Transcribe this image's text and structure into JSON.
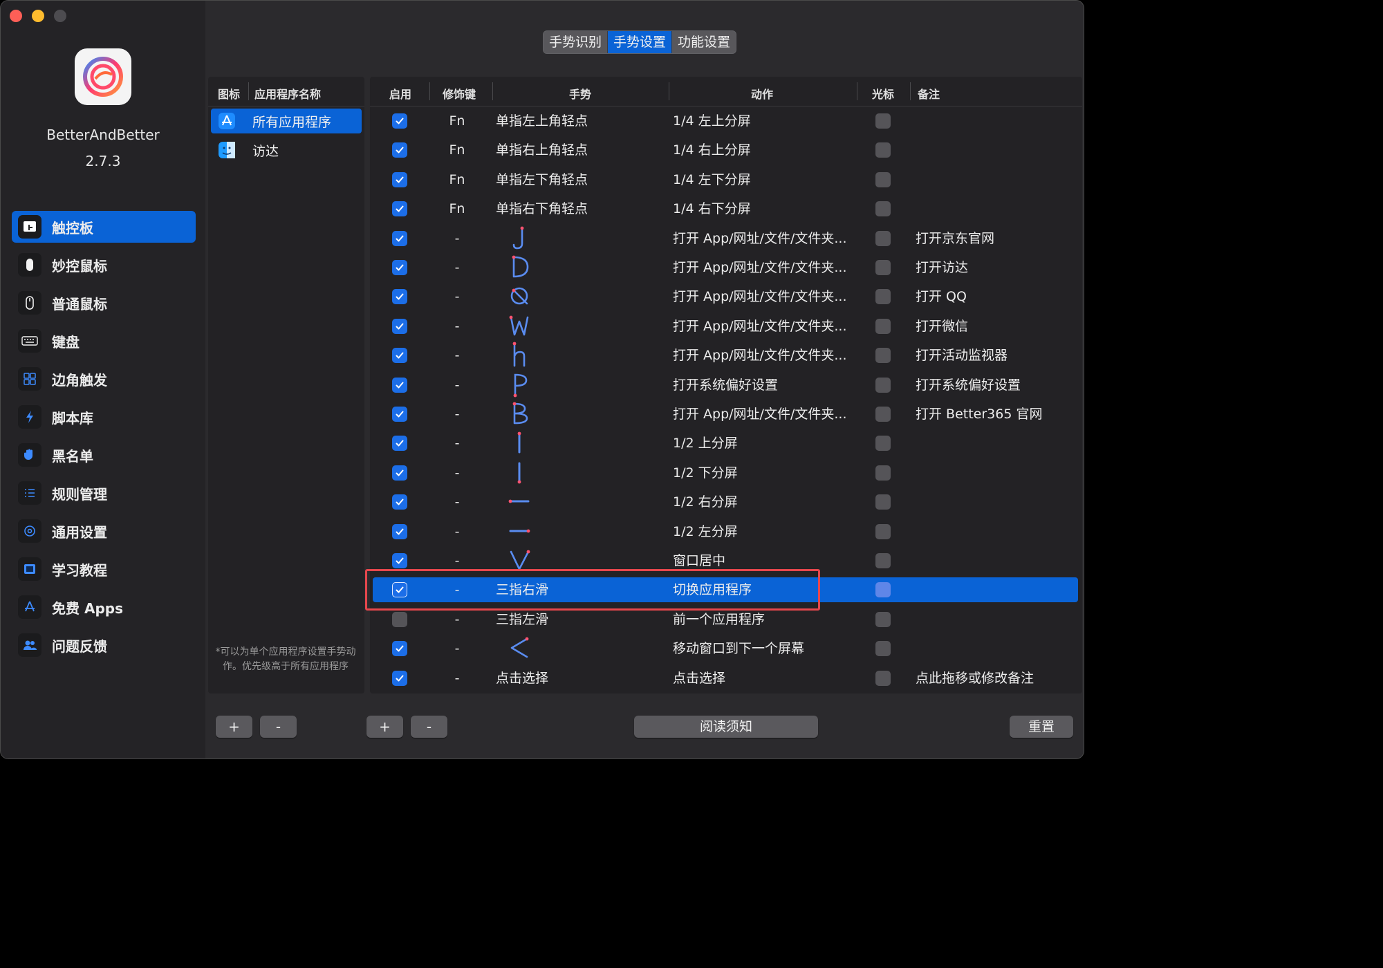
{
  "app": {
    "name": "BetterAndBetter",
    "version": "2.7.3"
  },
  "sidebar": {
    "items": [
      {
        "label": "触控板",
        "icon": "trackpad-icon"
      },
      {
        "label": "妙控鼠标",
        "icon": "magic-mouse-icon"
      },
      {
        "label": "普通鼠标",
        "icon": "mouse-icon"
      },
      {
        "label": "键盘",
        "icon": "keyboard-icon"
      },
      {
        "label": "边角触发",
        "icon": "hot-corners-icon"
      },
      {
        "label": "脚本库",
        "icon": "script-icon"
      },
      {
        "label": "黑名单",
        "icon": "hand-icon"
      },
      {
        "label": "规则管理",
        "icon": "list-icon"
      },
      {
        "label": "通用设置",
        "icon": "gear-icon"
      },
      {
        "label": "学习教程",
        "icon": "video-icon"
      },
      {
        "label": "免费 Apps",
        "icon": "app-store-icon"
      },
      {
        "label": "问题反馈",
        "icon": "people-icon"
      }
    ]
  },
  "tabs": [
    "手势识别",
    "手势设置",
    "功能设置"
  ],
  "app_list": {
    "headers": {
      "icon": "图标",
      "name": "应用程序名称"
    },
    "items": [
      {
        "label": "所有应用程序"
      },
      {
        "label": "访达"
      }
    ],
    "note": "*可以为单个应用程序设置手势动作。优先级高于所有应用程序"
  },
  "table": {
    "headers": {
      "enabled": "启用",
      "modifier": "修饰键",
      "gesture": "手势",
      "action": "动作",
      "cursor": "光标",
      "remark": "备注"
    },
    "rows": [
      {
        "enabled": true,
        "modifier": "Fn",
        "gesture": "单指左上角轻点",
        "action": "1/4 左上分屏",
        "remark": ""
      },
      {
        "enabled": true,
        "modifier": "Fn",
        "gesture": "单指右上角轻点",
        "action": "1/4 右上分屏",
        "remark": ""
      },
      {
        "enabled": true,
        "modifier": "Fn",
        "gesture": "单指左下角轻点",
        "action": "1/4 左下分屏",
        "remark": ""
      },
      {
        "enabled": true,
        "modifier": "Fn",
        "gesture": "单指右下角轻点",
        "action": "1/4 右下分屏",
        "remark": ""
      },
      {
        "enabled": true,
        "modifier": "-",
        "gesture": "",
        "glyph": "J",
        "action": "打开 App/网址/文件/文件夹...",
        "remark": "打开京东官网"
      },
      {
        "enabled": true,
        "modifier": "-",
        "gesture": "",
        "glyph": "D",
        "action": "打开 App/网址/文件/文件夹...",
        "remark": "打开访达"
      },
      {
        "enabled": true,
        "modifier": "-",
        "gesture": "",
        "glyph": "Q",
        "action": "打开 App/网址/文件/文件夹...",
        "remark": "打开 QQ"
      },
      {
        "enabled": true,
        "modifier": "-",
        "gesture": "",
        "glyph": "W",
        "action": "打开 App/网址/文件/文件夹...",
        "remark": "打开微信"
      },
      {
        "enabled": true,
        "modifier": "-",
        "gesture": "",
        "glyph": "h",
        "action": "打开 App/网址/文件/文件夹...",
        "remark": "打开活动监视器"
      },
      {
        "enabled": true,
        "modifier": "-",
        "gesture": "",
        "glyph": "P",
        "action": "打开系统偏好设置",
        "remark": "打开系统偏好设置"
      },
      {
        "enabled": true,
        "modifier": "-",
        "gesture": "",
        "glyph": "B",
        "action": "打开 App/网址/文件/文件夹...",
        "remark": "打开 Better365 官网"
      },
      {
        "enabled": true,
        "modifier": "-",
        "gesture": "",
        "glyph": "line-up",
        "action": "1/2 上分屏",
        "remark": ""
      },
      {
        "enabled": true,
        "modifier": "-",
        "gesture": "",
        "glyph": "line-down",
        "action": "1/2 下分屏",
        "remark": ""
      },
      {
        "enabled": true,
        "modifier": "-",
        "gesture": "",
        "glyph": "line-right",
        "action": "1/2 右分屏",
        "remark": ""
      },
      {
        "enabled": true,
        "modifier": "-",
        "gesture": "",
        "glyph": "line-left",
        "action": "1/2 左分屏",
        "remark": ""
      },
      {
        "enabled": true,
        "modifier": "-",
        "gesture": "",
        "glyph": "V",
        "action": "窗口居中",
        "remark": ""
      },
      {
        "enabled": true,
        "modifier": "-",
        "gesture": "三指右滑",
        "action": "切换应用程序",
        "remark": "",
        "selected": true
      },
      {
        "enabled": false,
        "modifier": "-",
        "gesture": "三指左滑",
        "action": "前一个应用程序",
        "remark": ""
      },
      {
        "enabled": true,
        "modifier": "-",
        "gesture": "",
        "glyph": "<",
        "action": "移动窗口到下一个屏幕",
        "remark": ""
      },
      {
        "enabled": true,
        "modifier": "-",
        "gesture": "点击选择",
        "action": "点击选择",
        "remark": "点此拖移或修改备注"
      }
    ]
  },
  "buttons": {
    "add": "+",
    "remove": "-",
    "read_notice": "阅读须知",
    "reset": "重置"
  },
  "colors": {
    "accent": "#0a63d6",
    "highlight": "#e7474d",
    "window_bg": "#2b2a2d",
    "sidebar_bg": "#242326"
  }
}
